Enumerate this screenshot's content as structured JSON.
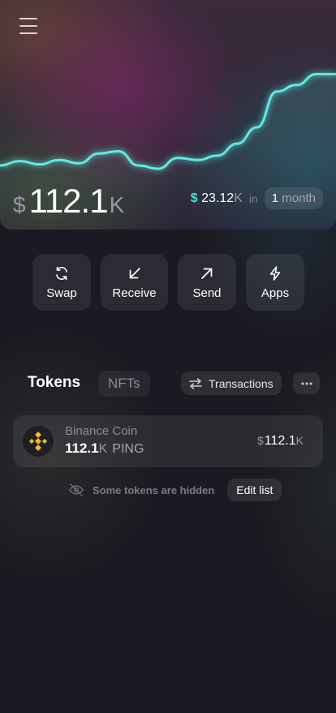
{
  "balance": {
    "currency": "$",
    "value": "112.1",
    "unit": "K"
  },
  "change": {
    "currency": "$",
    "value": "23.12",
    "unit": "K",
    "in_label": "in",
    "period_value": "1",
    "period_unit": "month"
  },
  "chart_data": {
    "type": "area",
    "points": [
      0.06,
      0.1,
      0.07,
      0.11,
      0.08,
      0.17,
      0.19,
      0.06,
      0.03,
      0.13,
      0.11,
      0.15,
      0.26,
      0.41,
      0.74,
      0.8,
      0.9,
      0.9
    ],
    "line_color": "#5ee9e3"
  },
  "actions": [
    {
      "label": "Swap",
      "icon": "swap-icon"
    },
    {
      "label": "Receive",
      "icon": "arrow-down-left-icon"
    },
    {
      "label": "Send",
      "icon": "arrow-up-right-icon"
    },
    {
      "label": "Apps",
      "icon": "lightning-icon"
    }
  ],
  "tabs": {
    "tokens": "Tokens",
    "nfts": "NFTs",
    "transactions": "Transactions"
  },
  "tokens": [
    {
      "name": "Binance Coin",
      "amount": "112.1",
      "amount_unit": "K",
      "symbol": "PING",
      "value_currency": "$",
      "value": "112.1",
      "value_unit": "K",
      "icon": "binance-icon",
      "icon_color": "#f3ba2f"
    }
  ],
  "hidden_notice": {
    "text": "Some tokens are hidden",
    "edit_label": "Edit list"
  }
}
